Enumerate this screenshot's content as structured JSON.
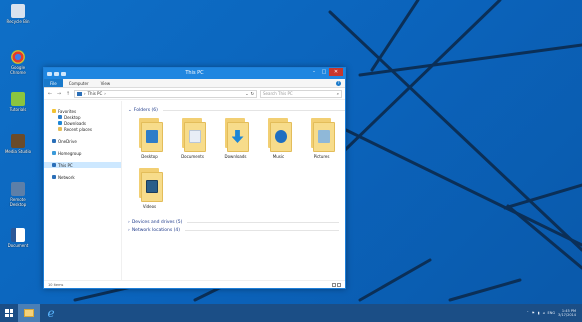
{
  "desktop": {
    "icons": [
      {
        "label": "Recycle Bin",
        "icon": "recycle-bin-icon",
        "color": "#d8e2ee"
      },
      {
        "label": "Google Chrome",
        "icon": "chrome-icon",
        "color": "#e23b2e"
      },
      {
        "label": "Tutorials",
        "icon": "app-icon",
        "color": "#8bc53f"
      },
      {
        "label": "Media Studio",
        "icon": "media-icon",
        "color": "#6a4b2a"
      },
      {
        "label": "Remote Desktop",
        "icon": "remote-desktop-icon",
        "color": "#5d7fa8"
      },
      {
        "label": "Document",
        "icon": "word-document-icon",
        "color": "#2b5797"
      }
    ]
  },
  "window": {
    "title": "This PC",
    "controls": {
      "minimize": "–",
      "maximize": "□",
      "close": "✕"
    },
    "ribbon_tabs": [
      "File",
      "Computer",
      "View"
    ],
    "address": {
      "path": "This PC",
      "separator": "›"
    },
    "search_placeholder": "Search This PC",
    "nav_pane": {
      "favorites": {
        "label": "Favorites",
        "items": [
          "Desktop",
          "Downloads",
          "Recent places"
        ]
      },
      "onedrive": "OneDrive",
      "homegroup": "Homegroup",
      "this_pc": "This PC",
      "network": "Network"
    },
    "folders_header": "Folders (6)",
    "folders": [
      {
        "label": "Desktop",
        "badge_color": "#2f7dc8"
      },
      {
        "label": "Documents",
        "badge_color": "#e8eef6"
      },
      {
        "label": "Downloads",
        "badge_color": "#1d86d6"
      },
      {
        "label": "Music",
        "badge_color": "#1f6fc1"
      },
      {
        "label": "Pictures",
        "badge_color": "#8fb8d8"
      },
      {
        "label": "Videos",
        "badge_color": "#2a5e8a"
      }
    ],
    "devices_header": "Devices and drives (5)",
    "network_header": "Network locations (4)",
    "status": "10 items"
  },
  "taskbar": {
    "ie_glyph": "e",
    "tray_lang": "ENG",
    "time": "1:45 PM",
    "date": "3/17/2014"
  }
}
